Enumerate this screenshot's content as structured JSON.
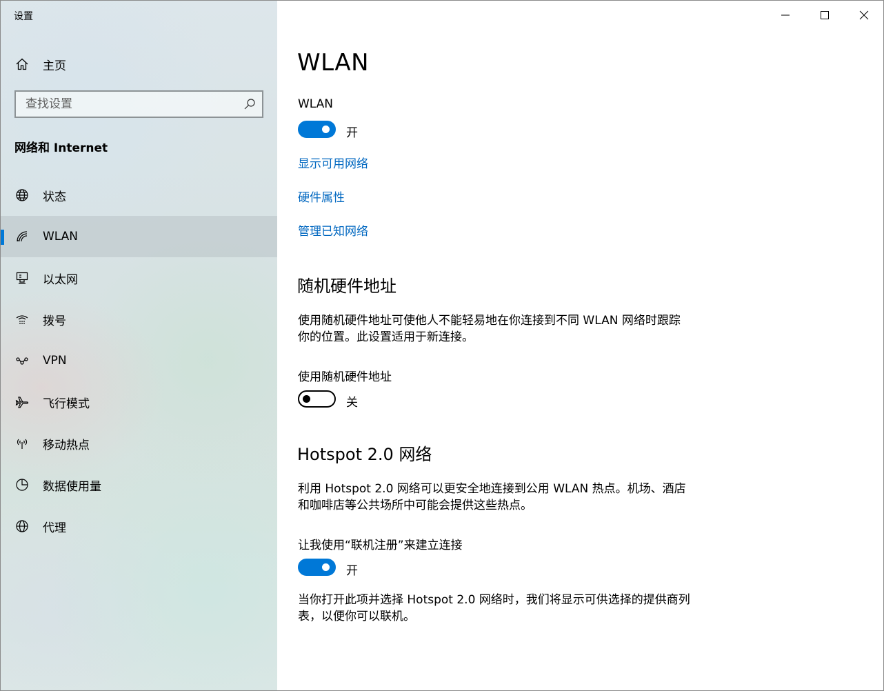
{
  "window": {
    "title": "设置"
  },
  "sidebar": {
    "home_label": "主页",
    "search_placeholder": "查找设置",
    "section_title": "网络和 Internet",
    "items": [
      {
        "label": "状态"
      },
      {
        "label": "WLAN"
      },
      {
        "label": "以太网"
      },
      {
        "label": "拨号"
      },
      {
        "label": "VPN"
      },
      {
        "label": "飞行模式"
      },
      {
        "label": "移动热点"
      },
      {
        "label": "数据使用量"
      },
      {
        "label": "代理"
      }
    ]
  },
  "main": {
    "title": "WLAN",
    "wlan_toggle": {
      "label": "WLAN",
      "state_text": "开"
    },
    "links": {
      "show_networks": "显示可用网络",
      "hardware_properties": "硬件属性",
      "manage_known": "管理已知网络"
    },
    "random_mac": {
      "heading": "随机硬件地址",
      "description": "使用随机硬件地址可使他人不能轻易地在你连接到不同 WLAN 网络时跟踪你的位置。此设置适用于新连接。",
      "toggle_label": "使用随机硬件地址",
      "state_text": "关"
    },
    "hotspot": {
      "heading": "Hotspot 2.0 网络",
      "description": "利用 Hotspot 2.0 网络可以更安全地连接到公用 WLAN 热点。机场、酒店和咖啡店等公共场所中可能会提供这些热点。",
      "toggle_label": "让我使用“联机注册”来建立连接",
      "state_text": "开",
      "note": "当你打开此项并选择 Hotspot 2.0 网络时，我们将显示可供选择的提供商列表，以便你可以联机。"
    }
  },
  "colors": {
    "accent": "#0078d7",
    "link": "#0067c0"
  }
}
